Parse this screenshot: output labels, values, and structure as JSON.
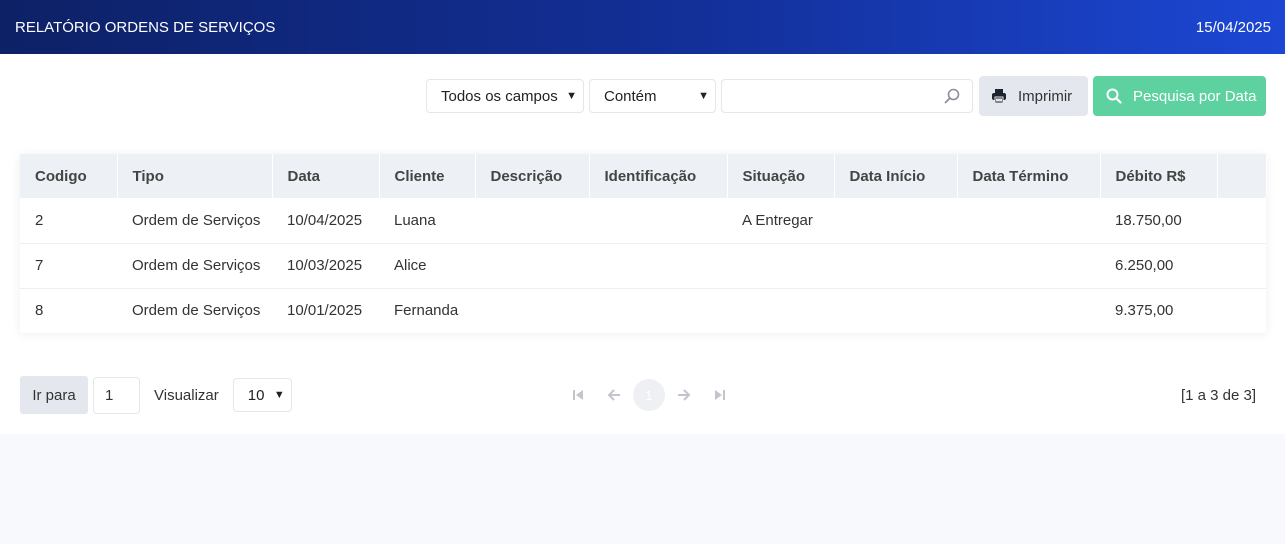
{
  "header": {
    "title": "RELATÓRIO ORDENS DE SERVIÇOS",
    "date": "15/04/2025"
  },
  "toolbar": {
    "field_select": "Todos os campos",
    "condition_select": "Contém",
    "search_value": "",
    "print_label": "Imprimir",
    "date_search_label": "Pesquisa por Data"
  },
  "table": {
    "columns": [
      "Codigo",
      "Tipo",
      "Data",
      "Cliente",
      "Descrição",
      "Identificação",
      "Situação",
      "Data Início",
      "Data Término",
      "Débito R$",
      ""
    ],
    "rows": [
      [
        "2",
        "Ordem de Serviços",
        "10/04/2025",
        "Luana",
        "",
        "",
        "A Entregar",
        "",
        "",
        "18.750,00",
        ""
      ],
      [
        "7",
        "Ordem de Serviços",
        "10/03/2025",
        "Alice",
        "",
        "",
        "",
        "",
        "",
        "6.250,00",
        ""
      ],
      [
        "8",
        "Ordem de Serviços",
        "10/01/2025",
        "Fernanda",
        "",
        "",
        "",
        "",
        "",
        "9.375,00",
        ""
      ]
    ]
  },
  "pagination": {
    "goto_label": "Ir para",
    "goto_value": "1",
    "view_label": "Visualizar",
    "rows_per_page": "10",
    "current_page": "1",
    "range_text": "[1 a 3 de 3]"
  },
  "icons": {
    "search": "search-icon",
    "print": "printer-icon",
    "first": "first-page-icon",
    "prev": "arrow-left-icon",
    "next": "arrow-right-icon",
    "last": "last-page-icon"
  },
  "colors": {
    "header_start": "#0d2166",
    "header_end": "#1c47d4",
    "date_button": "#5ed1a0",
    "print_button": "#e4e8ee"
  }
}
